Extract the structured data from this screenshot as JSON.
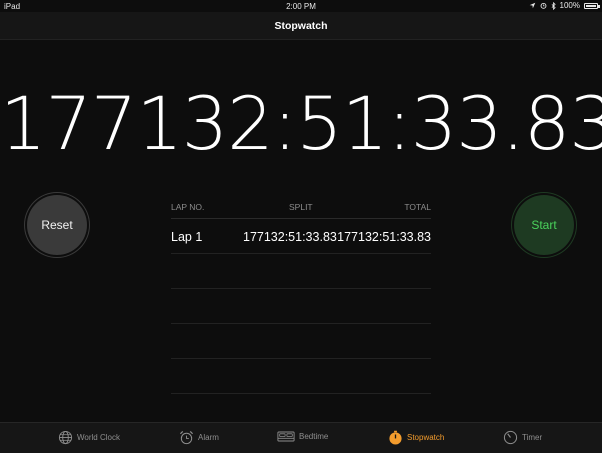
{
  "status_bar": {
    "device": "iPad",
    "time": "2:00 PM",
    "battery_percent": "100%",
    "battery_level": 1.0,
    "icons": [
      "location-icon",
      "alarm-icon",
      "bluetooth-icon",
      "battery-icon"
    ]
  },
  "nav": {
    "title": "Stopwatch"
  },
  "stopwatch": {
    "elapsed": "177132:51:33.83",
    "reset_label": "Reset",
    "start_label": "Start"
  },
  "laps": {
    "headers": {
      "lap": "LAP NO.",
      "split": "SPLIT",
      "total": "TOTAL"
    },
    "rows": [
      {
        "lap": "Lap 1",
        "split": "177132:51:33.83",
        "total": "177132:51:33.83"
      }
    ]
  },
  "tabs": {
    "world_clock": "World Clock",
    "alarm": "Alarm",
    "bedtime": "Bedtime",
    "stopwatch": "Stopwatch",
    "timer": "Timer",
    "active": "stopwatch"
  },
  "colors": {
    "accent": "#f39c2d",
    "start_green": "#4ad25c",
    "background": "#0d0d0d"
  }
}
